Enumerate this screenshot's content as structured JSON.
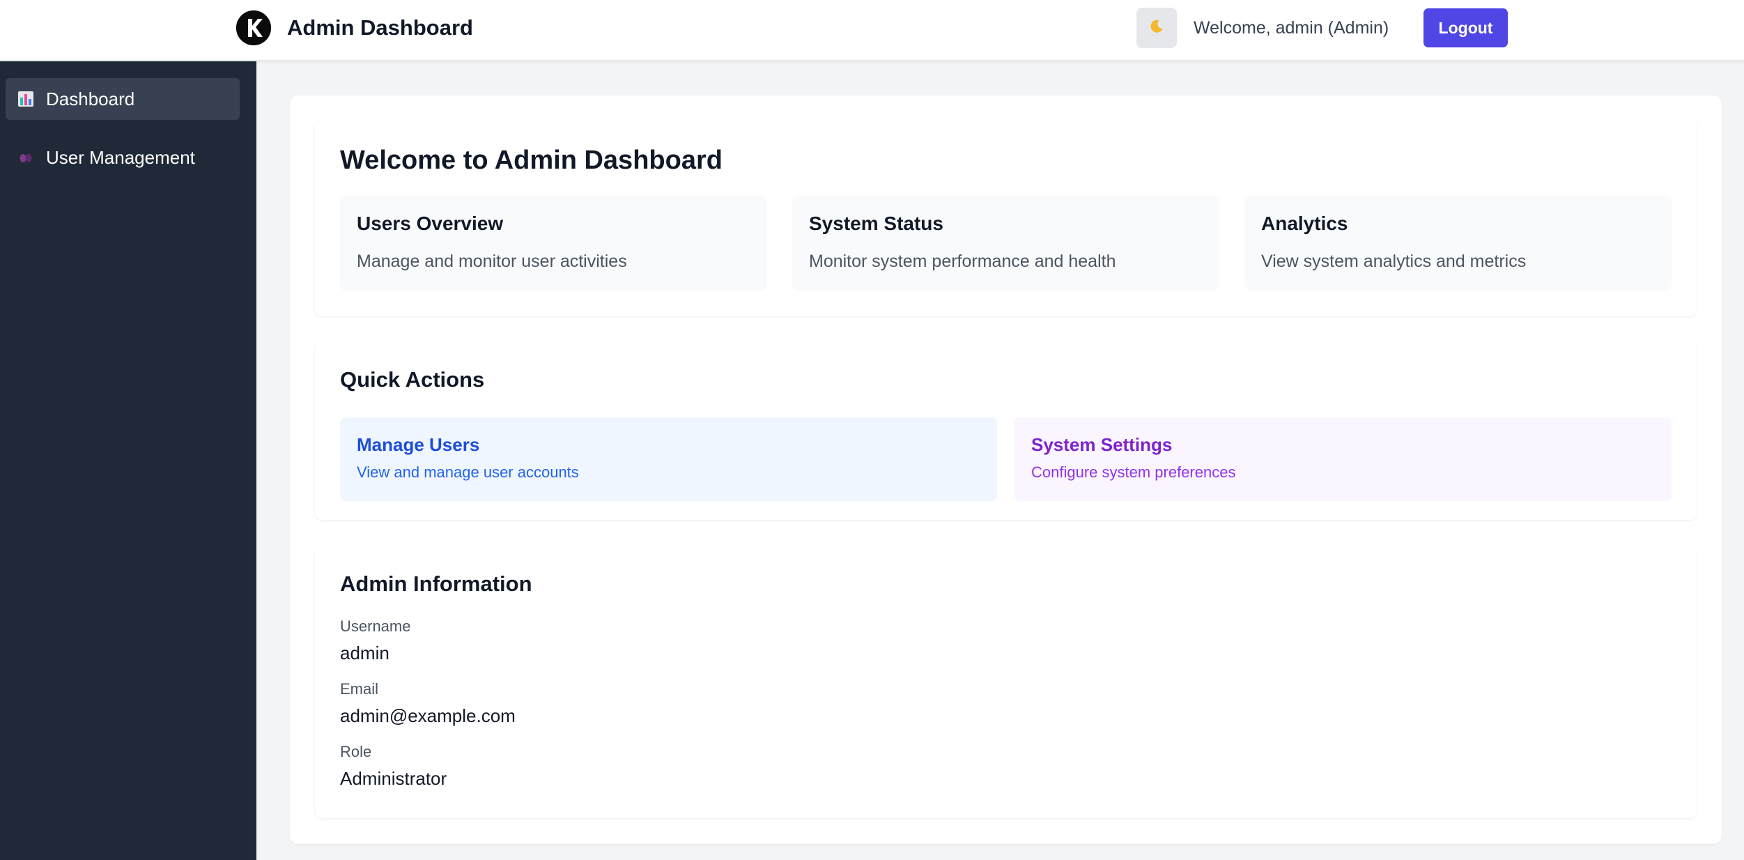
{
  "header": {
    "title": "Admin Dashboard",
    "logo_icon": "k-logo-icon",
    "theme_toggle_icon": "moon-icon",
    "welcome_text": "Welcome, admin (Admin)",
    "logout_label": "Logout",
    "accent_color": "#4f46e5"
  },
  "sidebar": {
    "items": [
      {
        "label": "Dashboard",
        "icon": "bar-chart-icon",
        "active": true
      },
      {
        "label": "User Management",
        "icon": "users-icon",
        "active": false
      }
    ]
  },
  "main": {
    "welcome": {
      "title": "Welcome to Admin Dashboard",
      "cards": [
        {
          "title": "Users Overview",
          "description": "Manage and monitor user activities"
        },
        {
          "title": "System Status",
          "description": "Monitor system performance and health"
        },
        {
          "title": "Analytics",
          "description": "View system analytics and metrics"
        }
      ]
    },
    "quick_actions": {
      "title": "Quick Actions",
      "actions": [
        {
          "title": "Manage Users",
          "description": "View and manage user accounts",
          "color": "#1d4ed8",
          "bg": "#eff6ff"
        },
        {
          "title": "System Settings",
          "description": "Configure system preferences",
          "color": "#7e22ce",
          "bg": "#faf5ff"
        }
      ]
    },
    "admin_info": {
      "title": "Admin Information",
      "fields": [
        {
          "label": "Username",
          "value": "admin"
        },
        {
          "label": "Email",
          "value": "admin@example.com"
        },
        {
          "label": "Role",
          "value": "Administrator"
        }
      ]
    }
  }
}
